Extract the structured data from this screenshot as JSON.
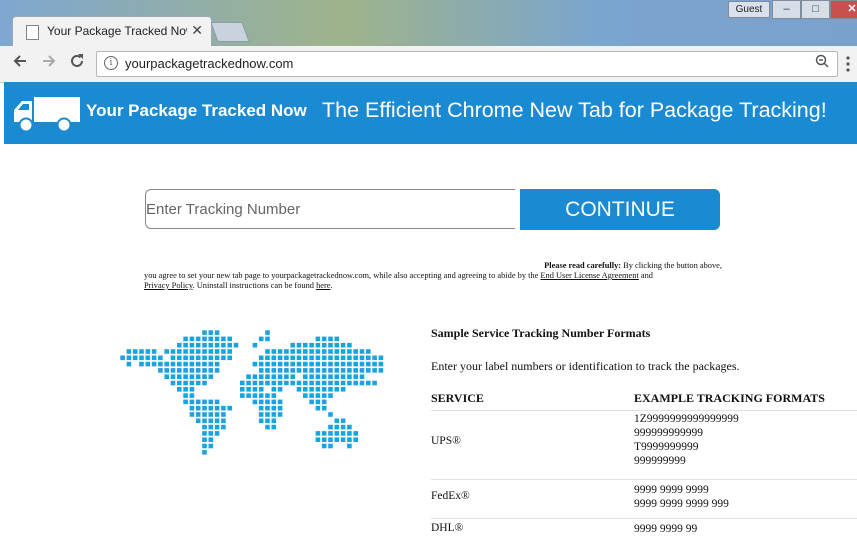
{
  "browser": {
    "tab_title": "Your Package Tracked Now",
    "tab_close": "✕",
    "profile": "Guest",
    "url": "yourpackagetrackednow.com",
    "window_buttons": [
      "–",
      "□",
      "✕"
    ]
  },
  "header": {
    "brand": "Your Package Tracked Now",
    "tagline": "The Efficient Chrome New Tab for Package Tracking!",
    "colors": {
      "accent": "#1a8ad2"
    }
  },
  "form": {
    "placeholder": "Enter Tracking Number",
    "button": "CONTINUE"
  },
  "legal": {
    "lead": "Please read carefully:",
    "line1_tail": " By clicking the button above,",
    "line2": "you agree to set your new tab page to yourpackagetrackednow.com, while also accepting and agreeing to abide by the ",
    "eula": "End User License Agreement",
    "and": " and",
    "privacy": "Privacy Policy",
    "uninstall": ". Uninstall instructions can be found ",
    "here": "here",
    "end": "."
  },
  "samples": {
    "title": "Sample Service Tracking Number Formats",
    "intro": "Enter your label numbers or identification to track the packages.",
    "col_service": "SERVICE",
    "col_formats": "EXAMPLE TRACKING FORMATS",
    "rows": [
      {
        "service": "UPS®",
        "formats": [
          "1Z9999999999999999",
          "999999999999",
          "T9999999999",
          "999999999"
        ]
      },
      {
        "service": "FedEx®",
        "formats": [
          "9999 9999 9999",
          "9999 9999 9999 999"
        ]
      },
      {
        "service": "DHL®",
        "formats": [
          "9999 9999 99"
        ]
      }
    ]
  },
  "icons": [
    "document-icon",
    "back-arrow-icon",
    "forward-arrow-icon",
    "reload-icon",
    "info-icon",
    "zoom-icon",
    "menu-icon",
    "truck-icon",
    "world-map-icon"
  ]
}
